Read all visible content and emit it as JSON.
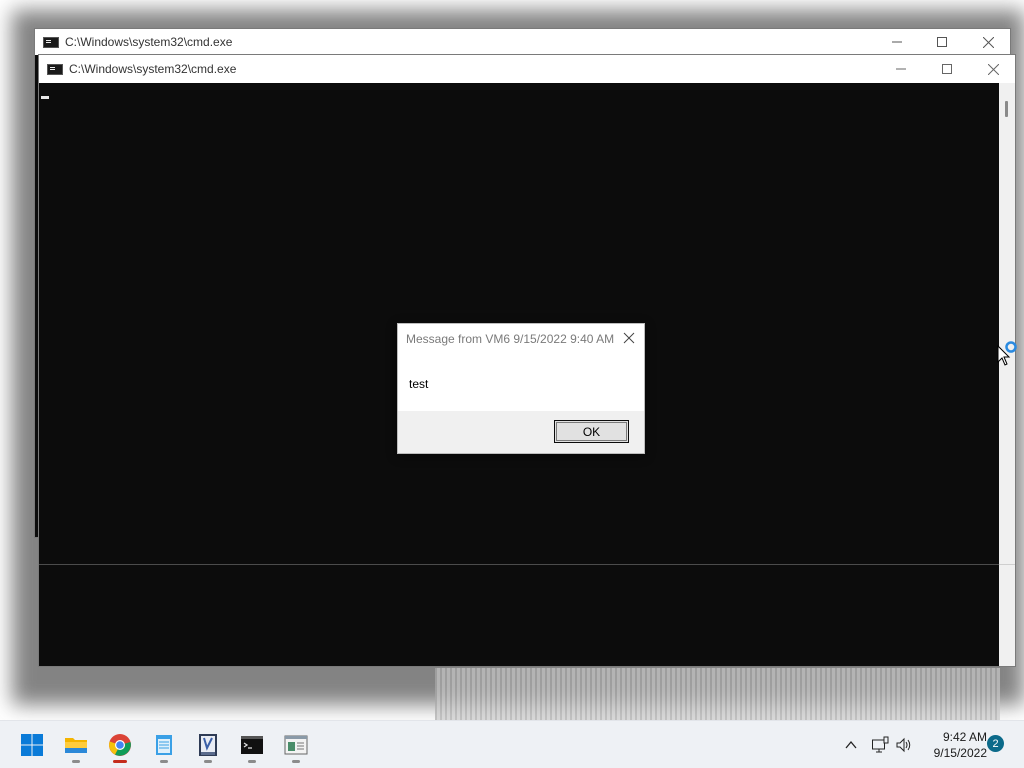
{
  "windows": {
    "back": {
      "title": "C:\\Windows\\system32\\cmd.exe"
    },
    "front": {
      "title": "C:\\Windows\\system32\\cmd.exe"
    }
  },
  "dialog": {
    "title": "Message from VM6 9/15/2022 9:40 AM",
    "message": "test",
    "ok_label": "OK"
  },
  "taskbar": {
    "apps": [
      {
        "name": "start",
        "icon": "windows-logo-icon"
      },
      {
        "name": "file-explorer",
        "icon": "folder-icon"
      },
      {
        "name": "chrome",
        "icon": "chrome-icon",
        "active": true
      },
      {
        "name": "notepad",
        "icon": "notepad-icon"
      },
      {
        "name": "editor",
        "icon": "editor-icon"
      },
      {
        "name": "cmd",
        "icon": "terminal-icon"
      },
      {
        "name": "app",
        "icon": "window-app-icon"
      }
    ],
    "tray": {
      "time": "9:42 AM",
      "date": "9/15/2022",
      "notification_count": "2"
    }
  },
  "colors": {
    "console_bg": "#0c0c0c",
    "taskbar_bg": "#eef1f5",
    "accent": "#0078d4",
    "badge": "#0b6a8a"
  }
}
